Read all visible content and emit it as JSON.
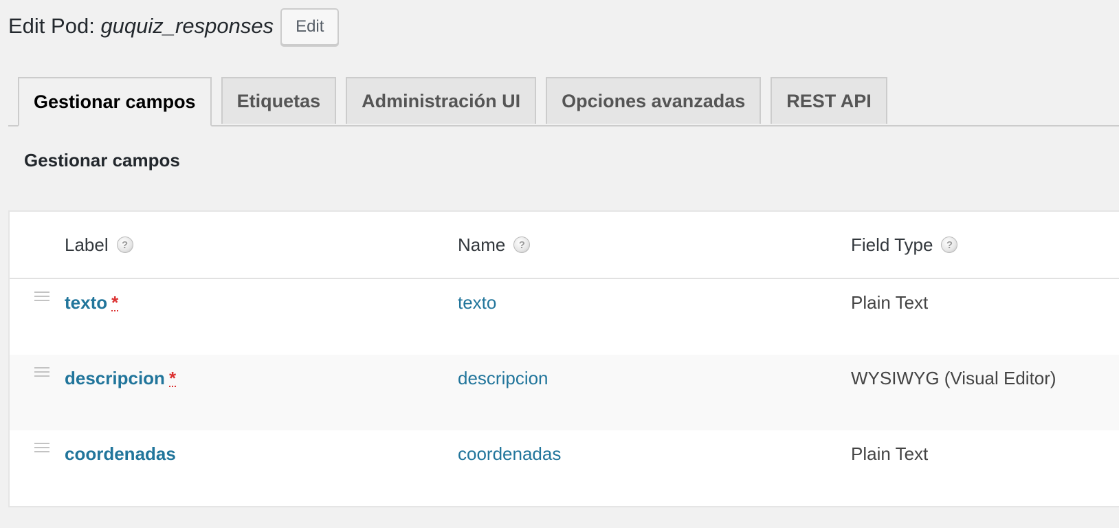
{
  "header": {
    "title_prefix": "Edit Pod:",
    "pod_name": "guquiz_responses",
    "edit_button": "Edit"
  },
  "tabs": [
    {
      "label": "Gestionar campos",
      "active": true
    },
    {
      "label": "Etiquetas",
      "active": false
    },
    {
      "label": "Administración UI",
      "active": false
    },
    {
      "label": "Opciones avanzadas",
      "active": false
    },
    {
      "label": "REST API",
      "active": false
    }
  ],
  "section": {
    "heading": "Gestionar campos"
  },
  "table": {
    "columns": {
      "label": "Label",
      "name": "Name",
      "field_type": "Field Type"
    },
    "help_icon": "question-mark-icon",
    "help_glyph": "?",
    "required_marker": "*",
    "rows": [
      {
        "label": "texto",
        "required": true,
        "name": "texto",
        "field_type": "Plain Text"
      },
      {
        "label": "descripcion",
        "required": true,
        "name": "descripcion",
        "field_type": "WYSIWYG (Visual Editor)"
      },
      {
        "label": "coordenadas",
        "required": false,
        "name": "coordenadas",
        "field_type": "Plain Text"
      }
    ]
  },
  "colors": {
    "link": "#21759b",
    "required": "#dc3232",
    "background": "#f1f1f1"
  }
}
